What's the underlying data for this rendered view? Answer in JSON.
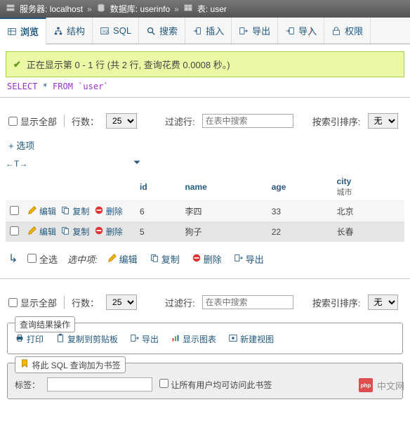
{
  "breadcrumb": {
    "server_label": "服务器:",
    "server_value": "localhost",
    "db_label": "数据库:",
    "db_value": "userinfo",
    "table_label": "表:",
    "table_value": "user"
  },
  "tabs": {
    "browse": "浏览",
    "structure": "结构",
    "sql": "SQL",
    "search": "搜索",
    "insert": "插入",
    "export": "导出",
    "import": "导入",
    "privileges": "权限"
  },
  "status": "正在显示第 0 - 1 行 (共 2 行, 查询花费 0.0008 秒。)",
  "query": {
    "raw": "SELECT * FROM `user`"
  },
  "filters": {
    "show_all": "显示全部",
    "rows_label": "行数：",
    "rows_value": "25",
    "filter_label": "过滤行:",
    "filter_placeholder": "在表中搜索",
    "sort_label": "按索引排序:",
    "sort_value": "无"
  },
  "options_link": "+ 选项",
  "columns": {
    "id": "id",
    "name": "name",
    "age": "age",
    "city": "city",
    "city_sub": "城市"
  },
  "row_actions": {
    "edit": "编辑",
    "copy": "复制",
    "delete": "删除"
  },
  "rows": [
    {
      "id": "6",
      "name": "李四",
      "age": "33",
      "city": "北京"
    },
    {
      "id": "5",
      "name": "狗子",
      "age": "22",
      "city": "长春"
    }
  ],
  "bulk": {
    "select_all": "全选",
    "selected_label": "选中项:",
    "edit": "编辑",
    "copy": "复制",
    "delete": "删除",
    "export": "导出"
  },
  "ops_box": {
    "title": "查询结果操作",
    "print": "打印",
    "copy_clip": "复制到剪贴板",
    "export": "导出",
    "chart": "显示图表",
    "view": "新建视图"
  },
  "bookmark_box": {
    "title": "将此 SQL 查询加为书签",
    "label_label": "标签：",
    "share_label": "让所有用户均可访问此书签"
  },
  "watermark": "中文网"
}
